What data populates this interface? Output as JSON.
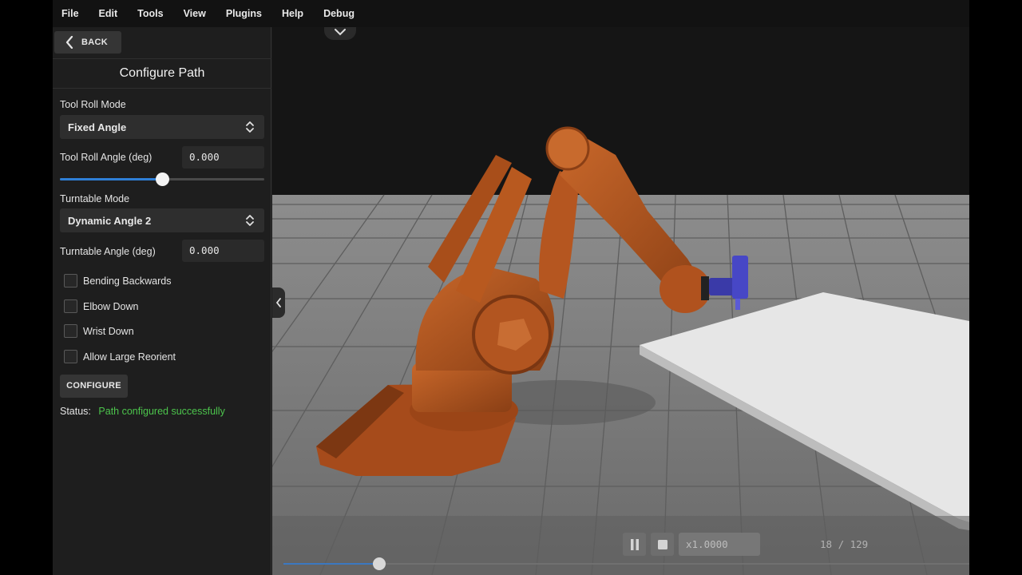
{
  "menu": [
    "File",
    "Edit",
    "Tools",
    "View",
    "Plugins",
    "Help",
    "Debug"
  ],
  "sidebar": {
    "back_label": "BACK",
    "title": "Configure Path",
    "tool_roll_mode": {
      "label": "Tool Roll Mode",
      "value": "Fixed Angle"
    },
    "tool_roll_angle": {
      "label": "Tool Roll Angle (deg)",
      "value": "0.000",
      "slider_fraction": 0.5
    },
    "turntable_mode": {
      "label": "Turntable Mode",
      "value": "Dynamic Angle 2"
    },
    "turntable_angle": {
      "label": "Turntable Angle (deg)",
      "value": "0.000"
    },
    "checkboxes": [
      {
        "label": "Bending Backwards",
        "checked": false
      },
      {
        "label": "Elbow Down",
        "checked": false
      },
      {
        "label": "Wrist Down",
        "checked": false
      },
      {
        "label": "Allow Large Reorient",
        "checked": false
      }
    ],
    "configure_label": "CONFIGURE",
    "status_label": "Status:",
    "status_value": "Path configured successfully"
  },
  "playback": {
    "speed": "x1.0000",
    "frame_text": "18 / 129",
    "current_frame": 18,
    "total_frames": 129
  },
  "colors": {
    "accent": "#2f7fd6",
    "status_ok": "#4cc44c",
    "robot": "#b4551f",
    "tool": "#3a3aa8"
  }
}
